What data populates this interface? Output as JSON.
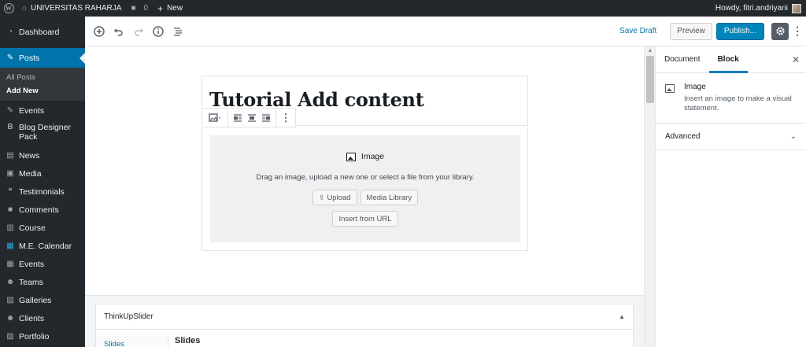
{
  "adminbar": {
    "site_name": "UNIVERSITAS RAHARJA",
    "comments_count": "0",
    "new_label": "New",
    "howdy": "Howdy, fitri.andriyani"
  },
  "sidebar": {
    "items": [
      {
        "label": "Dashboard",
        "icon": "dashboard-icon",
        "glyph": "◔"
      },
      {
        "label": "Posts",
        "icon": "pin-icon",
        "glyph": "✎"
      },
      {
        "label": "Events",
        "icon": "pin-icon",
        "glyph": "✎"
      },
      {
        "label": "Blog Designer Pack",
        "icon": "b-icon",
        "glyph": "B"
      },
      {
        "label": "News",
        "icon": "news-icon",
        "glyph": "▤"
      },
      {
        "label": "Media",
        "icon": "media-icon",
        "glyph": "▣"
      },
      {
        "label": "Testimonials",
        "icon": "quote-icon",
        "glyph": "❝"
      },
      {
        "label": "Comments",
        "icon": "comment-icon",
        "glyph": "■"
      },
      {
        "label": "Course",
        "icon": "course-icon",
        "glyph": "▥"
      },
      {
        "label": "M.E. Calendar",
        "icon": "calendar-icon",
        "glyph": "▦"
      },
      {
        "label": "Events",
        "icon": "events-calendar-icon",
        "glyph": "▦"
      },
      {
        "label": "Teams",
        "icon": "teams-icon",
        "glyph": "☻"
      },
      {
        "label": "Galleries",
        "icon": "gallery-icon",
        "glyph": "▧"
      },
      {
        "label": "Clients",
        "icon": "clients-icon",
        "glyph": "☻"
      },
      {
        "label": "Portfolio",
        "icon": "portfolio-icon",
        "glyph": "▨"
      }
    ],
    "submenu": [
      "All Posts",
      "Add New"
    ]
  },
  "toolbar": {
    "save_draft": "Save Draft",
    "preview": "Preview",
    "publish": "Publish..."
  },
  "editor": {
    "post_title": "Tutorial Add content",
    "image_block": {
      "title": "Image",
      "instructions": "Drag an image, upload a new one or select a file from your library.",
      "upload": "Upload",
      "media_library": "Media Library",
      "insert_url": "Insert from URL"
    }
  },
  "metabox": {
    "title": "ThinkUpSlider",
    "tab": "Slides",
    "section": "Slides"
  },
  "settings": {
    "tab_document": "Document",
    "tab_block": "Block",
    "block_name": "Image",
    "block_desc": "Insert an image to make a visual statement.",
    "advanced": "Advanced"
  },
  "colors": {
    "admin_dark": "#23282d",
    "wp_blue": "#0073aa",
    "publish_blue": "#0085ba"
  }
}
